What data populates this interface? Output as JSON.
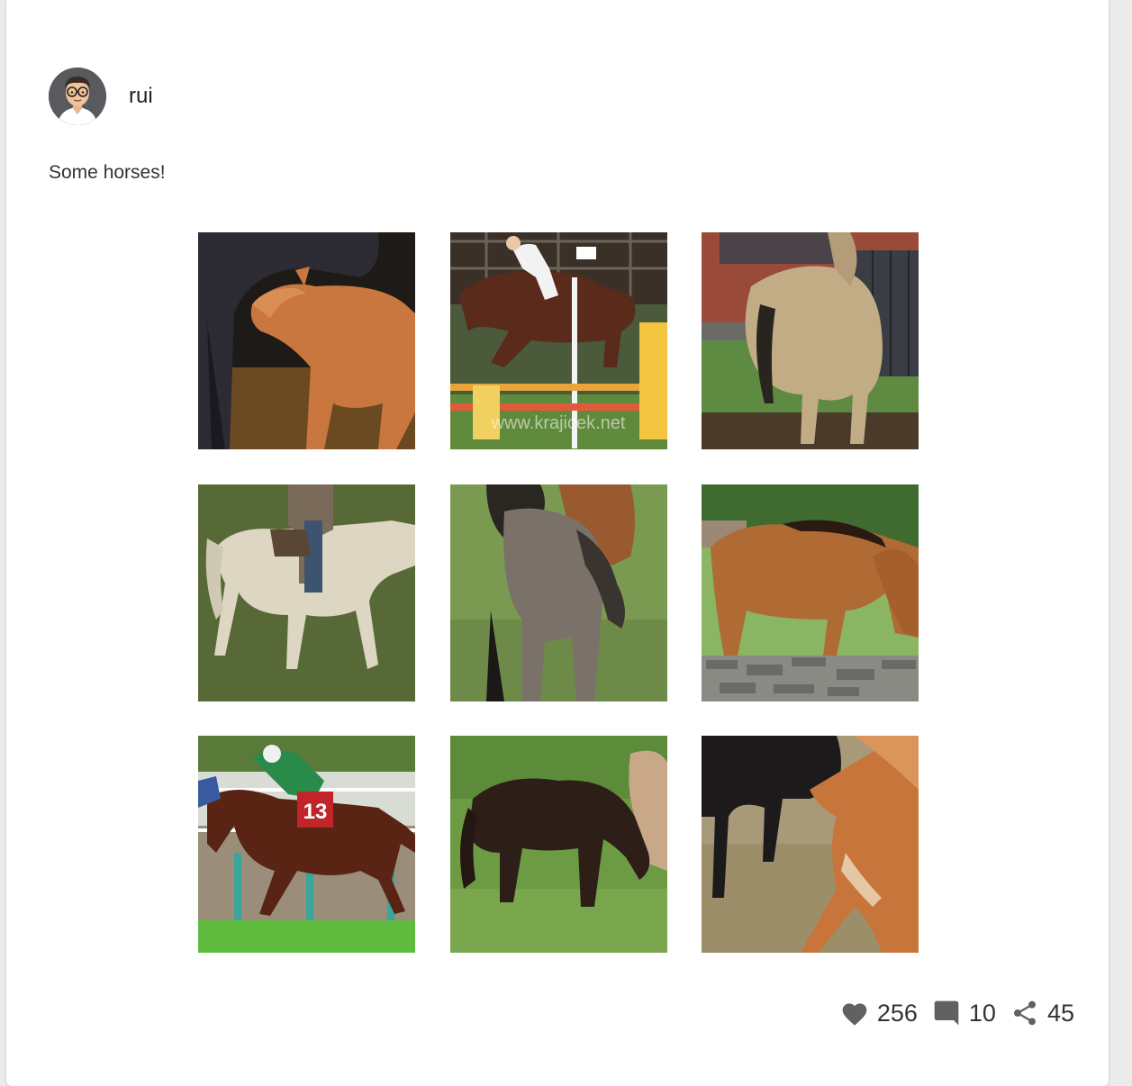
{
  "post": {
    "username": "rui",
    "text": "Some horses!",
    "avatar_icon": "person-with-glasses-avatar"
  },
  "gallery": [
    {
      "name": "photo-mare-and-foal",
      "icon": "horse-photo"
    },
    {
      "name": "photo-show-jumping",
      "icon": "horse-photo"
    },
    {
      "name": "photo-dun-horse",
      "icon": "horse-photo"
    },
    {
      "name": "photo-cream-horse-rider",
      "icon": "horse-photo"
    },
    {
      "name": "photo-grey-foal",
      "icon": "horse-photo"
    },
    {
      "name": "photo-bay-horse-stone-wall",
      "icon": "horse-photo"
    },
    {
      "name": "photo-racehorse",
      "icon": "horse-photo"
    },
    {
      "name": "photo-dark-pony-grazing",
      "icon": "horse-photo"
    },
    {
      "name": "photo-foal-and-black-horse",
      "icon": "horse-photo"
    }
  ],
  "actions": {
    "likes": "256",
    "comments": "10",
    "shares": "45",
    "icons": [
      "heart-icon",
      "comment-icon",
      "share-icon"
    ],
    "icon_color": "#616161"
  }
}
